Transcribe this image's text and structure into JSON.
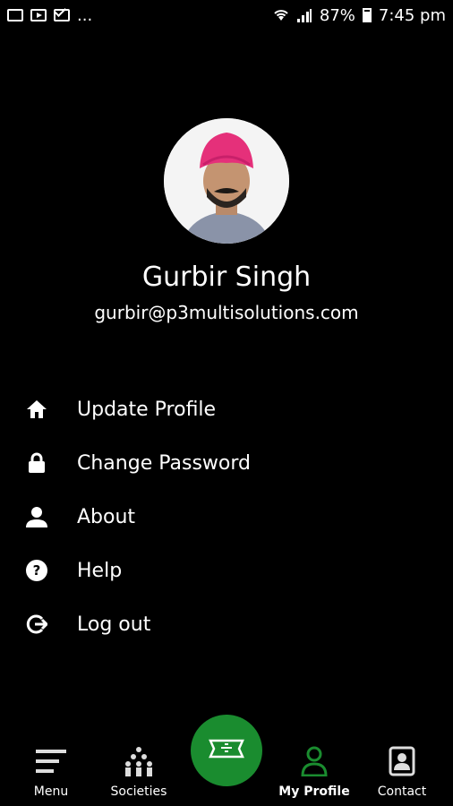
{
  "status_bar": {
    "left_icons": [
      "image-icon",
      "youtube-icon",
      "mail-icon"
    ],
    "overflow": "...",
    "battery": "87%",
    "time": "7:45 pm"
  },
  "profile": {
    "name": "Gurbir Singh",
    "email": "gurbir@p3multisolutions.com"
  },
  "menu": [
    {
      "label": "Update Profile",
      "icon": "home-icon"
    },
    {
      "label": "Change Password",
      "icon": "lock-icon"
    },
    {
      "label": "About",
      "icon": "person-icon"
    },
    {
      "label": "Help",
      "icon": "help-icon"
    },
    {
      "label": "Log out",
      "icon": "logout-icon"
    }
  ],
  "bottom_nav": {
    "items": [
      {
        "label": "Menu",
        "icon": "menu-icon"
      },
      {
        "label": "Societies",
        "icon": "societies-icon"
      },
      {
        "label": "My Profile",
        "icon": "profile-icon",
        "active": true
      },
      {
        "label": "Contact",
        "icon": "contact-icon"
      }
    ],
    "fab_icon": "ticket-icon"
  },
  "colors": {
    "background": "#000000",
    "accent": "#1a8c2f",
    "text": "#ffffff"
  }
}
